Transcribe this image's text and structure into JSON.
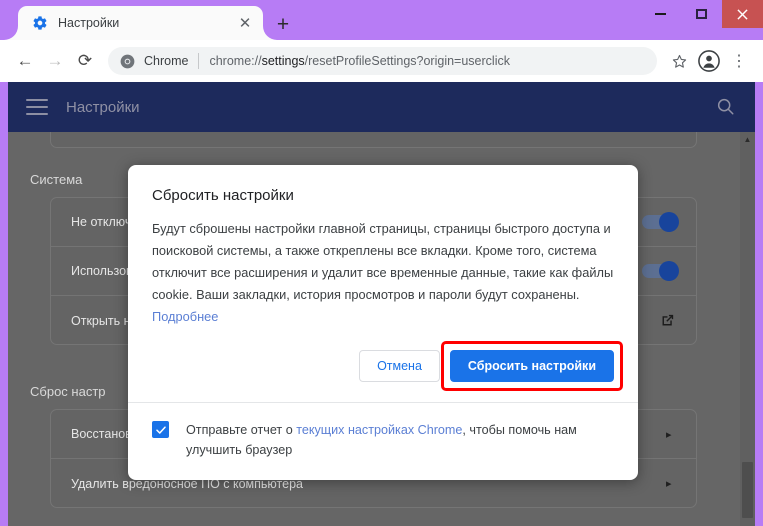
{
  "window": {
    "controls": {
      "minimize": "minimize",
      "maximize": "maximize",
      "close": "close"
    }
  },
  "tab": {
    "title": "Настройки",
    "favicon": "gear-icon",
    "close_label": "✕",
    "new_tab_label": "+"
  },
  "toolbar": {
    "back": "←",
    "forward": "→",
    "reload": "⟳",
    "chip_label": "Chrome",
    "url_prefix": "chrome://",
    "url_bold": "settings",
    "url_suffix": "/resetProfileSettings?origin=userclick",
    "bookmark": "☆",
    "profile": "profile-icon",
    "menu": "⋮"
  },
  "settings_header": {
    "title": "Настройки",
    "menu_icon": "hamburger-menu-icon",
    "search_icon": "search-icon"
  },
  "page": {
    "sections": [
      {
        "label": "Система",
        "rows": [
          {
            "label": "Не отключа",
            "control": "toggle",
            "control_state": "on"
          },
          {
            "label": "Использов",
            "control": "toggle",
            "control_state": "on"
          },
          {
            "label": "Открыть н",
            "control": "external-link"
          }
        ]
      },
      {
        "label": "Сброс настр",
        "rows": [
          {
            "label": "Восстанов",
            "control": "chevron"
          },
          {
            "label": "Удалить вредоносное ПО с компьютера",
            "control": "chevron"
          }
        ]
      }
    ],
    "chevron_glyph": "▸",
    "scrollbar_up_glyph": "▲"
  },
  "dialog": {
    "title": "Сбросить настройки",
    "body_part1": "Будут сброшены настройки главной страницы, страницы быстрого доступа и поисковой системы, а также откреплены все вкладки. Кроме того, система отключит все расширения и удалит все временные данные, такие как файлы cookie. Ваши закладки, история просмотров и пароли будут сохранены. ",
    "body_link": "Подробнее",
    "cancel_label": "Отмена",
    "confirm_label": "Сбросить настройки",
    "footer_part1": "Отправьте отчет о ",
    "footer_link": "текущих настройках Chrome",
    "footer_part2": ", чтобы помочь нам улучшить браузер",
    "checkbox_state": "checked",
    "checkbox_glyph": "✓"
  },
  "colors": {
    "window_chrome": "#b77cf5",
    "settings_header_bg": "#1d2a5c",
    "accent_blue": "#1a73e8",
    "link_blue": "#5b7fd4",
    "highlight_red": "#ff0000",
    "close_button_red": "#c75252",
    "dim_overlay": "#666666"
  }
}
